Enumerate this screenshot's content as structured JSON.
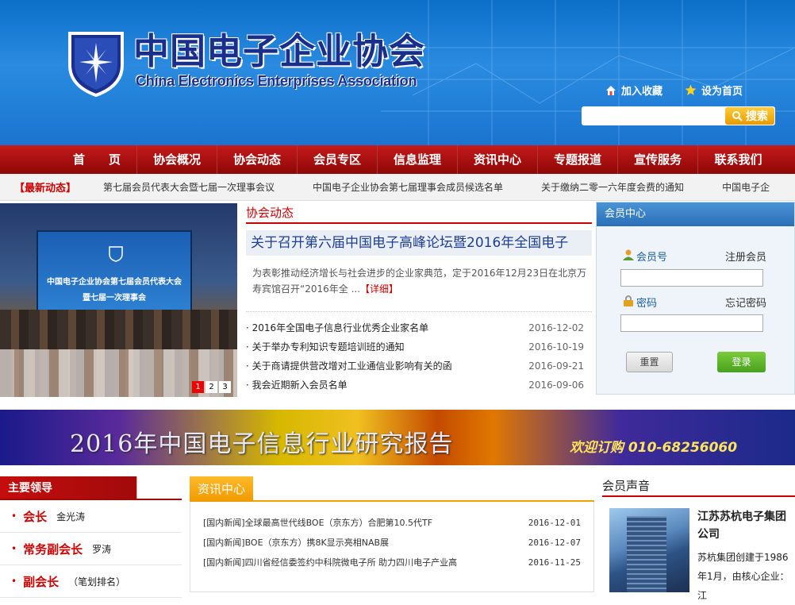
{
  "header": {
    "title": "中国电子企业协会",
    "subtitle": "China Electronics Enterprises Association",
    "bookmark_label": "加入收藏",
    "homepage_label": "设为首页",
    "search_placeholder": "",
    "search_label": "搜索"
  },
  "nav": {
    "items": [
      "首　　页",
      "协会概况",
      "协会动态",
      "会员专区",
      "信息监理",
      "资讯中心",
      "专题报道",
      "宣传服务",
      "联系我们"
    ]
  },
  "ticker": {
    "label": "【最新动态】",
    "items": [
      "第七届会员代表大会暨七届一次理事会议",
      "中国电子企业协会第七届理事会成员候选名单",
      "关于缴纳二零一六年度会费的通知",
      "中国电子企"
    ]
  },
  "slider": {
    "screen_line1": "中国电子企业协会第七届会员代表大会",
    "screen_line2": "暨七届一次理事会",
    "pages": [
      "1",
      "2",
      "3"
    ],
    "active_page": "1"
  },
  "news": {
    "section_title": "协会动态",
    "headline": "关于召开第六届中国电子高峰论坛暨2016年全国电子",
    "summary": "为表彰推动经济增长与社会进步的企业家典范，定于2016年12月23日在北京万寿宾馆召开“2016年全 ...",
    "more_label": "【详细】",
    "items": [
      {
        "title": "· 2016年全国电子信息行业优秀企业家名单",
        "date": "2016-12-02"
      },
      {
        "title": "· 关于举办专利知识专题培训班的通知",
        "date": "2016-10-19"
      },
      {
        "title": "· 关于商请提供营改增对工业通信业影响有关的函",
        "date": "2016-09-21"
      },
      {
        "title": "· 我会近期新入会员名单",
        "date": "2016-09-06"
      }
    ]
  },
  "member": {
    "title": "会员中心",
    "id_label": "会员号",
    "register_label": "注册会员",
    "password_label": "密码",
    "forgot_label": "忘记密码",
    "reset_label": "重置",
    "login_label": "登录"
  },
  "banner": {
    "title": "2016年中国电子信息行业研究报告",
    "phone": "欢迎订购  010-68256060"
  },
  "leaders": {
    "title": "主要领导",
    "items": [
      {
        "role": "会长",
        "name": "金光涛"
      },
      {
        "role": "常务副会长",
        "name": "罗涛"
      },
      {
        "role": "副会长",
        "name": "（笔划排名）"
      }
    ]
  },
  "info": {
    "title": "资讯中心",
    "items": [
      {
        "title": "[国内新闻]全球最高世代线BOE（京东方）合肥第10.5代TF",
        "date": "2016-12-01"
      },
      {
        "title": "[国内新闻]BOE（京东方）携8K显示亮相NAB展",
        "date": "2016-12-07"
      },
      {
        "title": "[国内新闻]四川省经信委签约中科院微电子所 助力四川电子产业高",
        "date": "2016-11-25"
      }
    ]
  },
  "voice": {
    "title": "会员声音",
    "company": "江苏苏杭电子集团公司",
    "desc": "苏杭集团创建于1986年1月，由核心企业：江"
  },
  "colors": {
    "brand_red": "#c00",
    "brand_blue": "#1a74cf",
    "accent_orange": "#f5a200"
  }
}
